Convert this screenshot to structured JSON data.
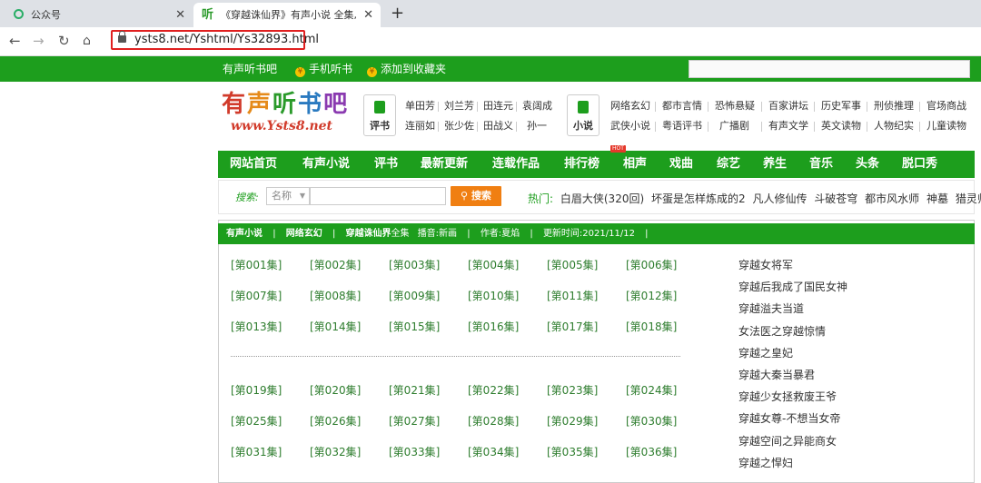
{
  "browser": {
    "tabs": [
      {
        "title": "公众号"
      },
      {
        "title": "《穿越诛仙界》有声小说 全集,"
      }
    ],
    "tab2_favicon": "听",
    "new_tab": "+",
    "close_glyph": "✕",
    "url": "ysts8.net/Yshtml/Ys32893.html",
    "icons": [
      "back-icon",
      "forward-icon",
      "reload-icon",
      "home-icon",
      "lock-icon"
    ]
  },
  "topbar": {
    "site_name": "有声听书吧",
    "mobile": "手机听书",
    "favorite": "添加到收藏夹"
  },
  "logo": {
    "cn": "有声听书吧",
    "en": "www.Ysts8.net"
  },
  "header": {
    "pingshu_label": "评书",
    "pingshu_links": [
      [
        "单田芳",
        "刘兰芳",
        "田连元",
        "袁阔成"
      ],
      [
        "连丽如",
        "张少佐",
        "田战义",
        "孙一"
      ]
    ],
    "novel_label": "小说",
    "novel_links": [
      [
        "网络玄幻",
        "都市言情",
        "恐怖悬疑",
        "百家讲坛",
        "历史军事",
        "刑侦推理",
        "官场商战"
      ],
      [
        "武侠小说",
        "粤语评书",
        "广播剧",
        "有声文学",
        "英文读物",
        "人物纪实",
        "儿童读物"
      ]
    ]
  },
  "mainnav": [
    "网站首页",
    "有声小说",
    "评书",
    "最新更新",
    "连载作品",
    "排行榜",
    "相声",
    "戏曲",
    "综艺",
    "养生",
    "音乐",
    "头条",
    "脱口秀"
  ],
  "hot_badge": "HOT",
  "search": {
    "label": "搜索:",
    "select_value": "名称",
    "button": "搜索",
    "hot_label": "热门:",
    "hot_items": [
      "白眉大侠(320回)",
      "坏蛋是怎样炼成的2",
      "凡人修仙传",
      "斗破苍穹",
      "都市风水师",
      "神墓",
      "猎灵师"
    ]
  },
  "crumb": {
    "c1": "有声小说",
    "c2": "网络玄幻",
    "title": "穿越诛仙界",
    "full": "全集",
    "announcer": "播音:新画",
    "author": "作者:夏焰",
    "updated": "更新时间:2021/11/12",
    "sep": "|"
  },
  "episodes_a": [
    "[第001集]",
    "[第002集]",
    "[第003集]",
    "[第004集]",
    "[第005集]",
    "[第006集]",
    "[第007集]",
    "[第008集]",
    "[第009集]",
    "[第010集]",
    "[第011集]",
    "[第012集]",
    "[第013集]",
    "[第014集]",
    "[第015集]",
    "[第016集]",
    "[第017集]",
    "[第018集]"
  ],
  "episodes_b": [
    "[第019集]",
    "[第020集]",
    "[第021集]",
    "[第022集]",
    "[第023集]",
    "[第024集]",
    "[第025集]",
    "[第026集]",
    "[第027集]",
    "[第028集]",
    "[第029集]",
    "[第030集]",
    "[第031集]",
    "[第032集]",
    "[第033集]",
    "[第034集]",
    "[第035集]",
    "[第036集]"
  ],
  "related": [
    "穿越女将军",
    "穿越后我成了国民女神",
    "穿越溢夫当道",
    "女法医之穿越惊情",
    "穿越之皇妃",
    "穿越大秦当暴君",
    "穿越少女拯救废王爷",
    "穿越女尊-不想当女帝",
    "穿越空间之异能商女",
    "穿越之悍妇"
  ],
  "colors": {
    "green": "#1d9e1d",
    "orange": "#f07f12",
    "hot_red": "#e5392b",
    "url_box_red": "#e02020"
  }
}
